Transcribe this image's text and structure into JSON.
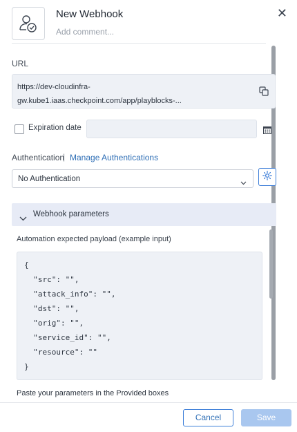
{
  "header": {
    "title": "New Webhook",
    "comment_placeholder": "Add comment...",
    "close_icon": "close-icon"
  },
  "url": {
    "label": "URL",
    "line1": "https://dev-cloudinfra-",
    "line2": "gw.kube1.iaas.checkpoint.com/app/playblocks-..."
  },
  "expiration": {
    "label": "Expiration date",
    "checked": false
  },
  "authentication": {
    "label": "Authentication",
    "separator": "|",
    "manage_link": "Manage Authentications",
    "selected": "No Authentication"
  },
  "webhook_params": {
    "title": "Webhook parameters",
    "payload_label": "Automation expected payload (example input)",
    "code_lines": [
      "{",
      "  \"src\": \"\",",
      "  \"attack_info\": \"\",",
      "  \"dst\": \"\",",
      "  \"orig\": \"\",",
      "  \"service_id\": \"\",",
      "  \"resource\": \"\"",
      "}"
    ],
    "paste_label": "Paste your parameters in the Provided boxes"
  },
  "footer": {
    "cancel_label": "Cancel",
    "save_label": "Save"
  },
  "colors": {
    "accent": "#3b7dd8",
    "link": "#2f6fb6",
    "input_bg": "#eef1f6",
    "section_bg": "#e7ebf6",
    "save_disabled": "#a9c7ef"
  }
}
